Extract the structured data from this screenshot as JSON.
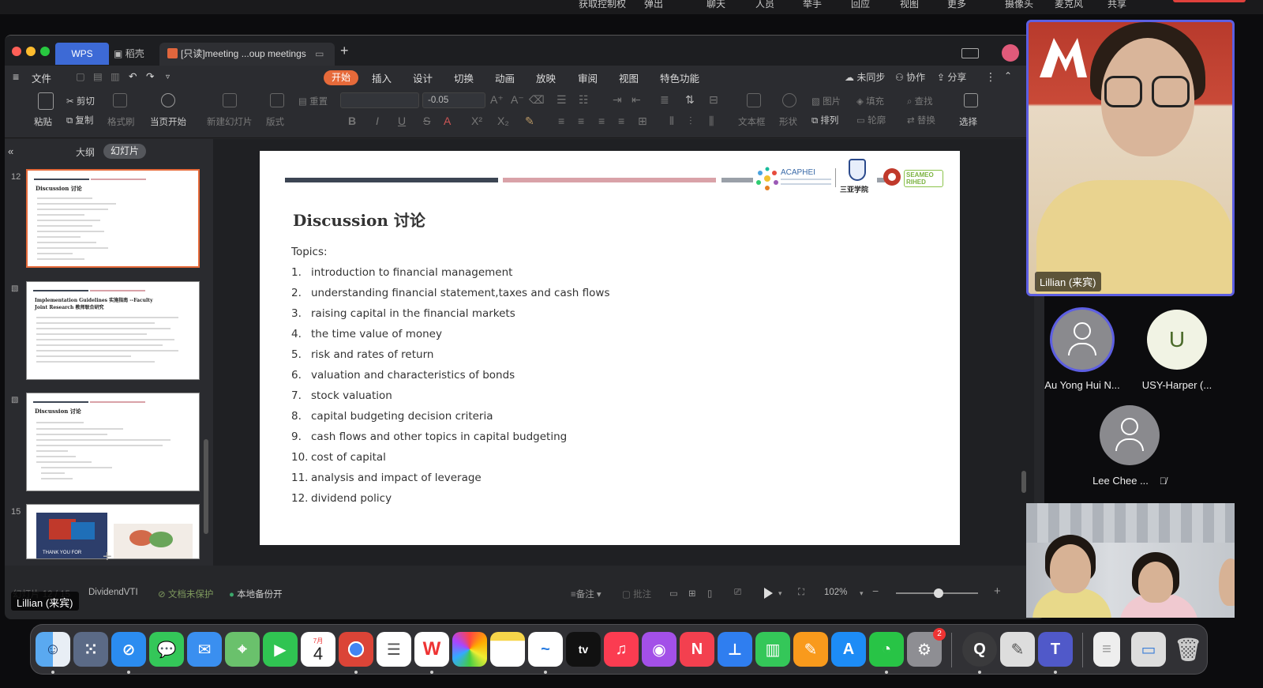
{
  "zoom_top": {
    "items": [
      "获取控制权",
      "弹出",
      "聊天",
      "人员",
      "举手",
      "回应",
      "视图",
      "更多",
      "摄像头",
      "麦克风",
      "共享"
    ]
  },
  "wps": {
    "tabs": {
      "wps": "WPS",
      "docer": "稻壳",
      "active": "[只读]meeting ...oup meetings"
    },
    "menu": {
      "file": "文件",
      "active": "开始",
      "items": [
        "插入",
        "设计",
        "切换",
        "动画",
        "放映",
        "审阅",
        "视图",
        "特色功能"
      ],
      "right": [
        "未同步",
        "协作",
        "分享"
      ]
    },
    "ribbon": {
      "paste": "粘贴",
      "cut": "剪切",
      "copy": "复制",
      "format_painter": "格式刷",
      "from_current": "当页开始",
      "new_slide": "新建幻灯片",
      "layout": "版式",
      "reset": "重置",
      "font_size": "-0.05",
      "textbox": "文本框",
      "shape": "形状",
      "picture": "图片",
      "arrange": "排列",
      "fill": "填充",
      "outline": "轮廓",
      "find": "查找",
      "replace": "替换",
      "select": "选择"
    },
    "left_panel": {
      "tab_outline": "大纲",
      "tab_slides": "幻灯片",
      "thumb_numbers": [
        "12",
        "",
        "",
        "15"
      ],
      "thumb1_title": "Discussion 讨论",
      "thumb2_title": "Implementation Guidelines 实施指南 --Faculty Joint Research 教师联合研究",
      "thumb3_title": "Discussion 讨论",
      "thumb4_title": "THANK YOU FOR"
    },
    "slide": {
      "logo_acaphei": "ACAPHEI",
      "logo_sanya": "三亚学院",
      "logo_seameo": "SEAMEO RIHED",
      "title": "Discussion  讨论",
      "topics_label": "Topics:",
      "topics": [
        {
          "n": "1.",
          "t": "introduction to financial management"
        },
        {
          "n": "2.",
          "t": "understanding financial statement,taxes and cash flows"
        },
        {
          "n": "3.",
          "t": "raising capital in the financial markets"
        },
        {
          "n": "4.",
          "t": "the time value of money"
        },
        {
          "n": "5.",
          "t": "risk and rates of return"
        },
        {
          "n": "6.",
          "t": "valuation and characteristics of bonds"
        },
        {
          "n": "7.",
          "t": "stock valuation"
        },
        {
          "n": "8.",
          "t": "capital budgeting decision criteria"
        },
        {
          "n": "9.",
          "t": "cash flows and other topics in capital budgeting"
        },
        {
          "n": "10.",
          "t": "cost of capital"
        },
        {
          "n": "11.",
          "t": "analysis and impact of  leverage"
        },
        {
          "n": "12.",
          "t": "dividend policy"
        }
      ]
    },
    "status": {
      "slide_count": "幻灯片 12 / 15",
      "theme": "DividendVTI",
      "protection": "文档未保护",
      "backup": "本地备份开",
      "notes": "备注",
      "comments": "批注",
      "zoom": "102%"
    }
  },
  "share_name": "Lillian (来宾)",
  "zoom_panel": {
    "main_video_label": "Lillian (来宾)",
    "participants": [
      {
        "name": "Au Yong Hui N...",
        "initial": ""
      },
      {
        "name": "USY-Harper (...",
        "initial": "U"
      },
      {
        "name": "Lee Chee ...",
        "initial": ""
      }
    ]
  },
  "dock": {
    "calendar_month": "7月",
    "calendar_day": "4",
    "settings_badge": "2",
    "apps": [
      "Finder",
      "Launchpad",
      "Safari",
      "Messages",
      "Mail",
      "Maps",
      "FaceTime",
      "Calendar",
      "Chrome",
      "Reminders",
      "WPS Office",
      "Photos",
      "Notes",
      "Freeform",
      "Apple TV",
      "Music",
      "Podcasts",
      "News",
      "Keynote",
      "Numbers",
      "Pages",
      "App Store",
      "WeChat",
      "System Settings",
      "QuickTime",
      "Script Editor",
      "Teams",
      "Document",
      "Preview",
      "Trash"
    ]
  }
}
